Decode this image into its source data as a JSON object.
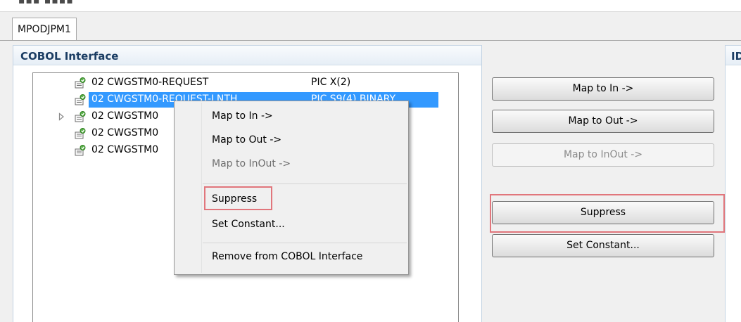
{
  "editor": {
    "tab_label": "MPODJPM1",
    "section_title": "COBOL Interface",
    "right_section_title_fragment": "ID"
  },
  "tree": {
    "rows": [
      {
        "name": "02 CWGSTM0-REQUEST",
        "type": "PIC X(2)"
      },
      {
        "name": "02 CWGSTM0-REQUEST-LNTH",
        "type": "PIC S9(4) BINARY"
      },
      {
        "name": "02 CWGSTM0",
        "type": ""
      },
      {
        "name": "02 CWGSTM0",
        "type": ""
      },
      {
        "name": "02 CWGSTM0",
        "type": ""
      }
    ]
  },
  "buttons": {
    "map_to_in": "Map to In ->",
    "map_to_out": "Map to Out ->",
    "map_to_inout": "Map to InOut ->",
    "suppress": "Suppress",
    "set_constant": "Set Constant..."
  },
  "context_menu": {
    "map_to_in": "Map to In ->",
    "map_to_out": "Map to Out ->",
    "map_to_inout": "Map to InOut ->",
    "suppress": "Suppress",
    "set_constant": "Set Constant...",
    "remove": "Remove from COBOL Interface"
  },
  "colors": {
    "selection": "#3399ff",
    "highlight_frame": "#e1767c",
    "section_title": "#1b3d63"
  },
  "icons": {
    "tree_item": "cobol-field-icon",
    "expander": "tree-expand-icon"
  }
}
